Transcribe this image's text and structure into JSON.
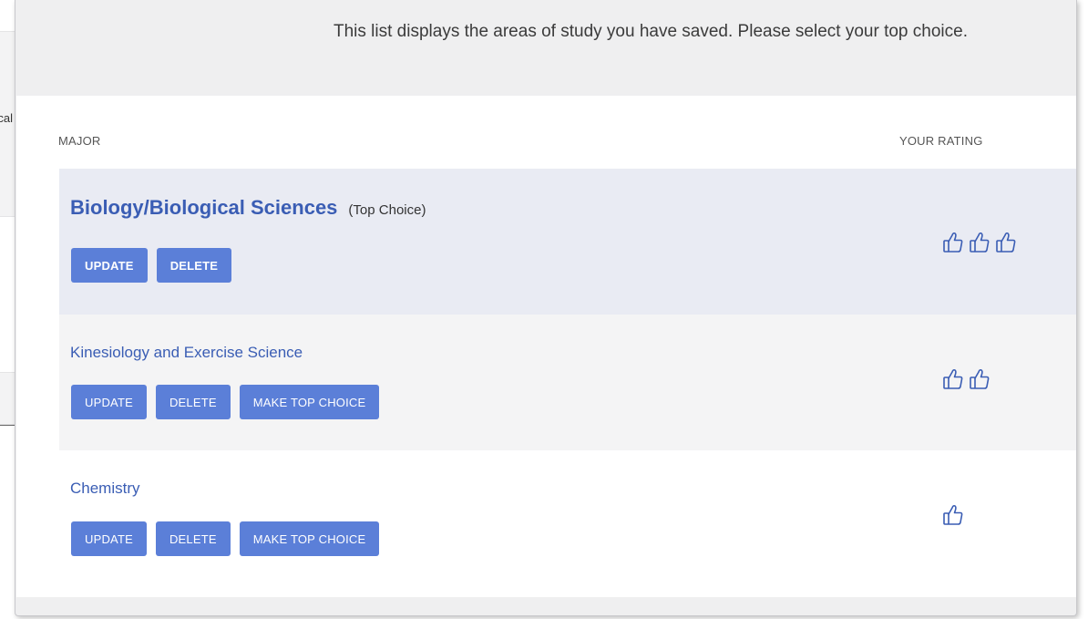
{
  "background": {
    "partial_text": "cal"
  },
  "header": {
    "instructions": "This list displays the areas of study you have saved. Please select your top choice."
  },
  "table": {
    "col_major": "MAJOR",
    "col_rating": "YOUR RATING"
  },
  "rows": [
    {
      "name": "Biology/Biological Sciences",
      "tag": "(Top Choice)",
      "update_label": "UPDATE",
      "delete_label": "DELETE",
      "rating": 3
    },
    {
      "name": "Kinesiology and Exercise Science",
      "update_label": "UPDATE",
      "delete_label": "DELETE",
      "make_top_label": "MAKE TOP CHOICE",
      "rating": 2
    },
    {
      "name": "Chemistry",
      "update_label": "UPDATE",
      "delete_label": "DELETE",
      "make_top_label": "MAKE TOP CHOICE",
      "rating": 1
    }
  ],
  "rating_icon": "thumbs-up-icon",
  "colors": {
    "accent": "#5b7fd8",
    "title": "#3a5db4",
    "top_row_bg": "#e9ebf3"
  }
}
